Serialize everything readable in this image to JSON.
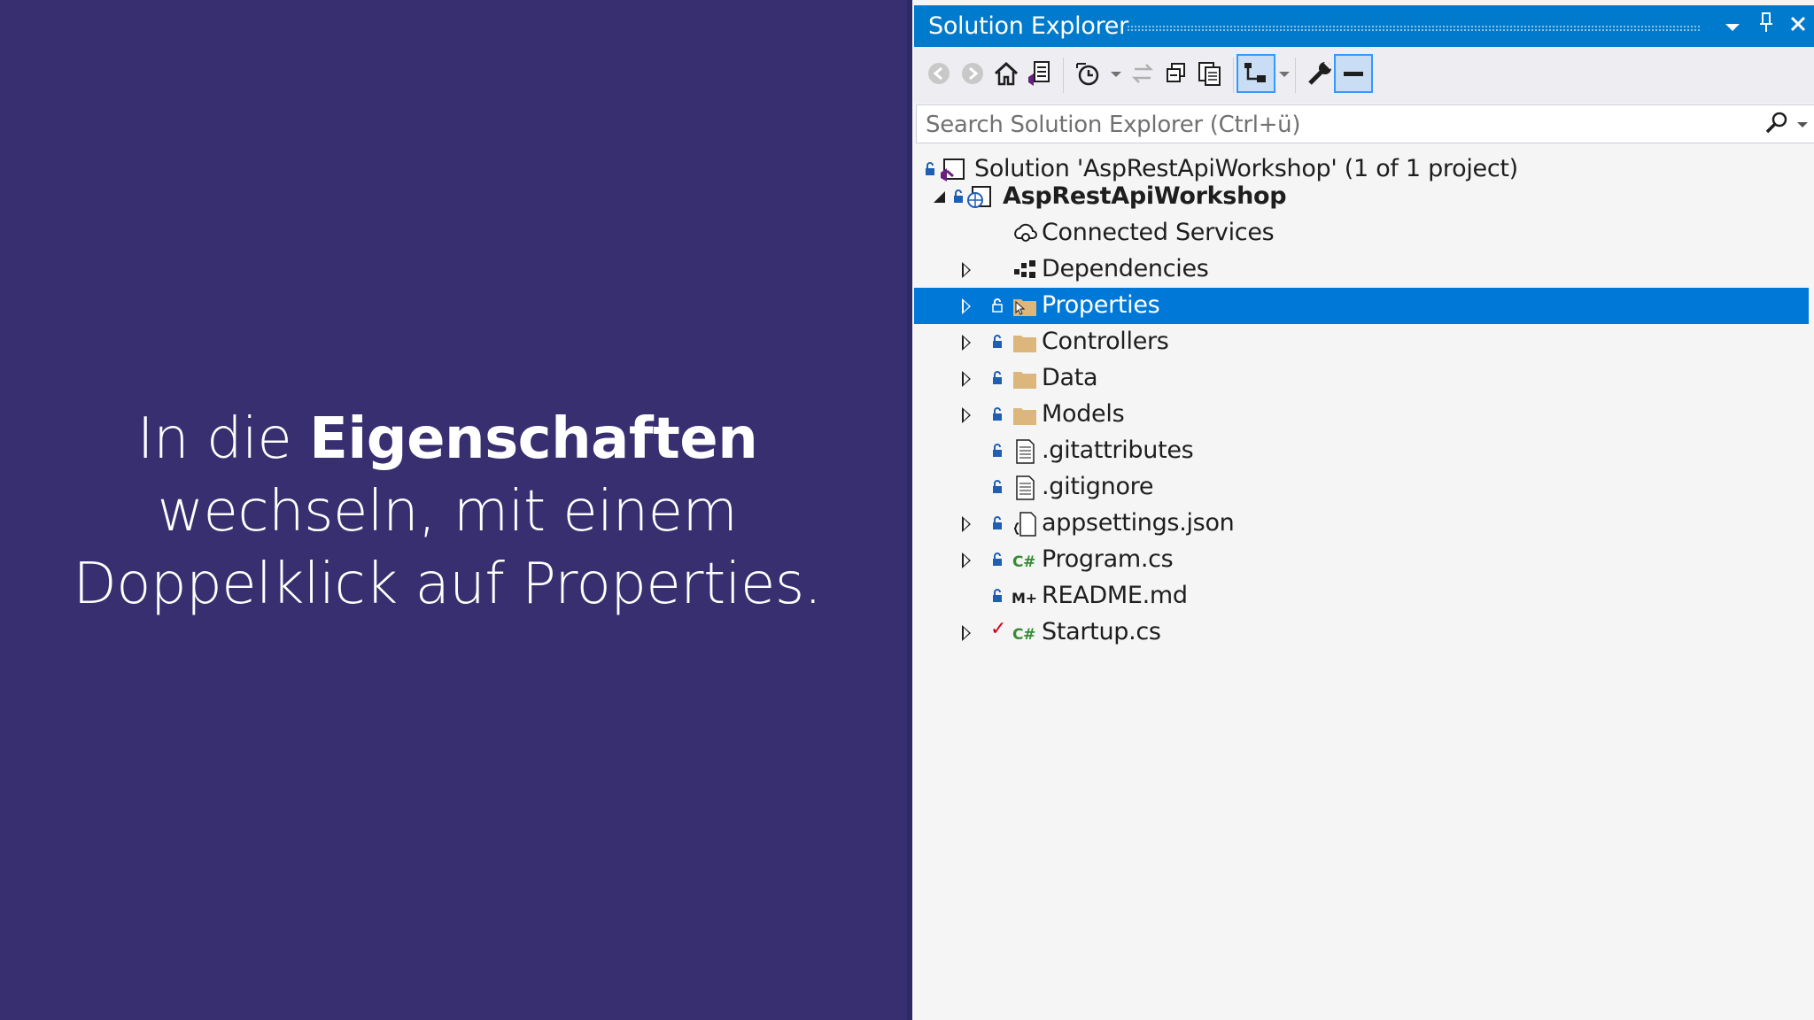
{
  "caption": {
    "pre": "In die ",
    "bold": "Eigenschaften",
    "post": " wechseln, mit einem Doppelklick auf Properties."
  },
  "solution_explorer": {
    "title": "Solution Explorer",
    "search_placeholder": "Search Solution Explorer (Ctrl+ü)",
    "tree": [
      {
        "label": "Solution 'AspRestApiWorkshop' (1 of 1 project)",
        "icon": "solution-icon"
      },
      {
        "label": "AspRestApiWorkshop",
        "icon": "web-project-icon",
        "bold": true
      },
      {
        "label": "Connected Services",
        "icon": "connected-services-icon"
      },
      {
        "label": "Dependencies",
        "icon": "dependencies-icon"
      },
      {
        "label": "Properties",
        "icon": "properties-folder-icon",
        "selected": true
      },
      {
        "label": "Controllers",
        "icon": "folder-icon"
      },
      {
        "label": "Data",
        "icon": "folder-icon"
      },
      {
        "label": "Models",
        "icon": "folder-icon"
      },
      {
        "label": ".gitattributes",
        "icon": "text-file-icon"
      },
      {
        "label": ".gitignore",
        "icon": "text-file-icon"
      },
      {
        "label": "appsettings.json",
        "icon": "json-file-icon"
      },
      {
        "label": "Program.cs",
        "icon": "csharp-file-icon"
      },
      {
        "label": "README.md",
        "icon": "markdown-file-icon"
      },
      {
        "label": "Startup.cs",
        "icon": "csharp-file-icon"
      }
    ],
    "colors": {
      "title_bar": "#007acc",
      "selection": "#0078d7",
      "background": "#f5f5f5",
      "caption_background": "#372f6f"
    }
  }
}
